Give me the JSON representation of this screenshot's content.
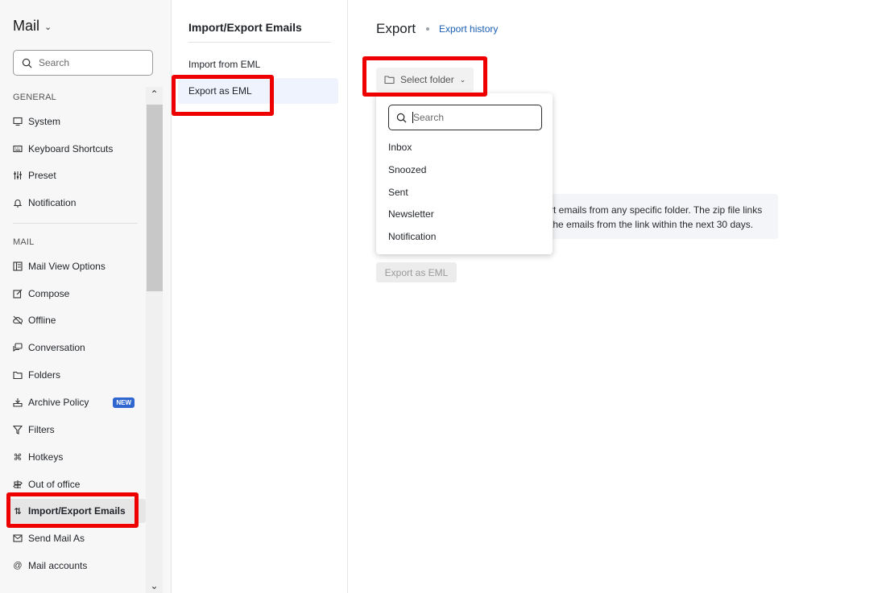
{
  "sidebar": {
    "app_title": "Mail",
    "search_placeholder": "Search",
    "sections": [
      {
        "label": "GENERAL"
      },
      {
        "label": "MAIL"
      }
    ],
    "general_items": [
      {
        "label": "System",
        "icon": "monitor-icon"
      },
      {
        "label": "Keyboard Shortcuts",
        "icon": "keyboard-icon"
      },
      {
        "label": "Preset",
        "icon": "sliders-icon"
      },
      {
        "label": "Notification",
        "icon": "bell-icon"
      }
    ],
    "mail_items": [
      {
        "label": "Mail View Options",
        "icon": "layout-icon"
      },
      {
        "label": "Compose",
        "icon": "edit-icon"
      },
      {
        "label": "Offline",
        "icon": "cloud-off-icon"
      },
      {
        "label": "Conversation",
        "icon": "chat-icon"
      },
      {
        "label": "Folders",
        "icon": "folder-icon"
      },
      {
        "label": "Archive Policy",
        "icon": "archive-icon",
        "badge": "NEW"
      },
      {
        "label": "Filters",
        "icon": "filter-icon"
      },
      {
        "label": "Hotkeys",
        "icon": "command-icon"
      },
      {
        "label": "Out of office",
        "icon": "signpost-icon"
      },
      {
        "label": "Import/Export Emails",
        "icon": "swap-icon"
      },
      {
        "label": "Send Mail As",
        "icon": "send-as-icon"
      },
      {
        "label": "Mail accounts",
        "icon": "at-icon"
      }
    ],
    "badge_color": "#2f66d0"
  },
  "middle": {
    "title": "Import/Export Emails",
    "items": [
      {
        "label": "Import from EML"
      },
      {
        "label": "Export as EML"
      }
    ]
  },
  "main": {
    "title": "Export",
    "history_link": "Export history",
    "select_folder_label": "Select folder",
    "info_line1": "rt emails from any specific folder. The zip file links",
    "info_line2": "the emails from the link within the next 30 days.",
    "export_button": "Export as EML",
    "link_color": "#1a5fb4"
  },
  "dropdown": {
    "search_placeholder": "Search",
    "folders": [
      "Inbox",
      "Snoozed",
      "Sent",
      "Newsletter",
      "Notification"
    ]
  },
  "highlight_color": "#ee0000"
}
